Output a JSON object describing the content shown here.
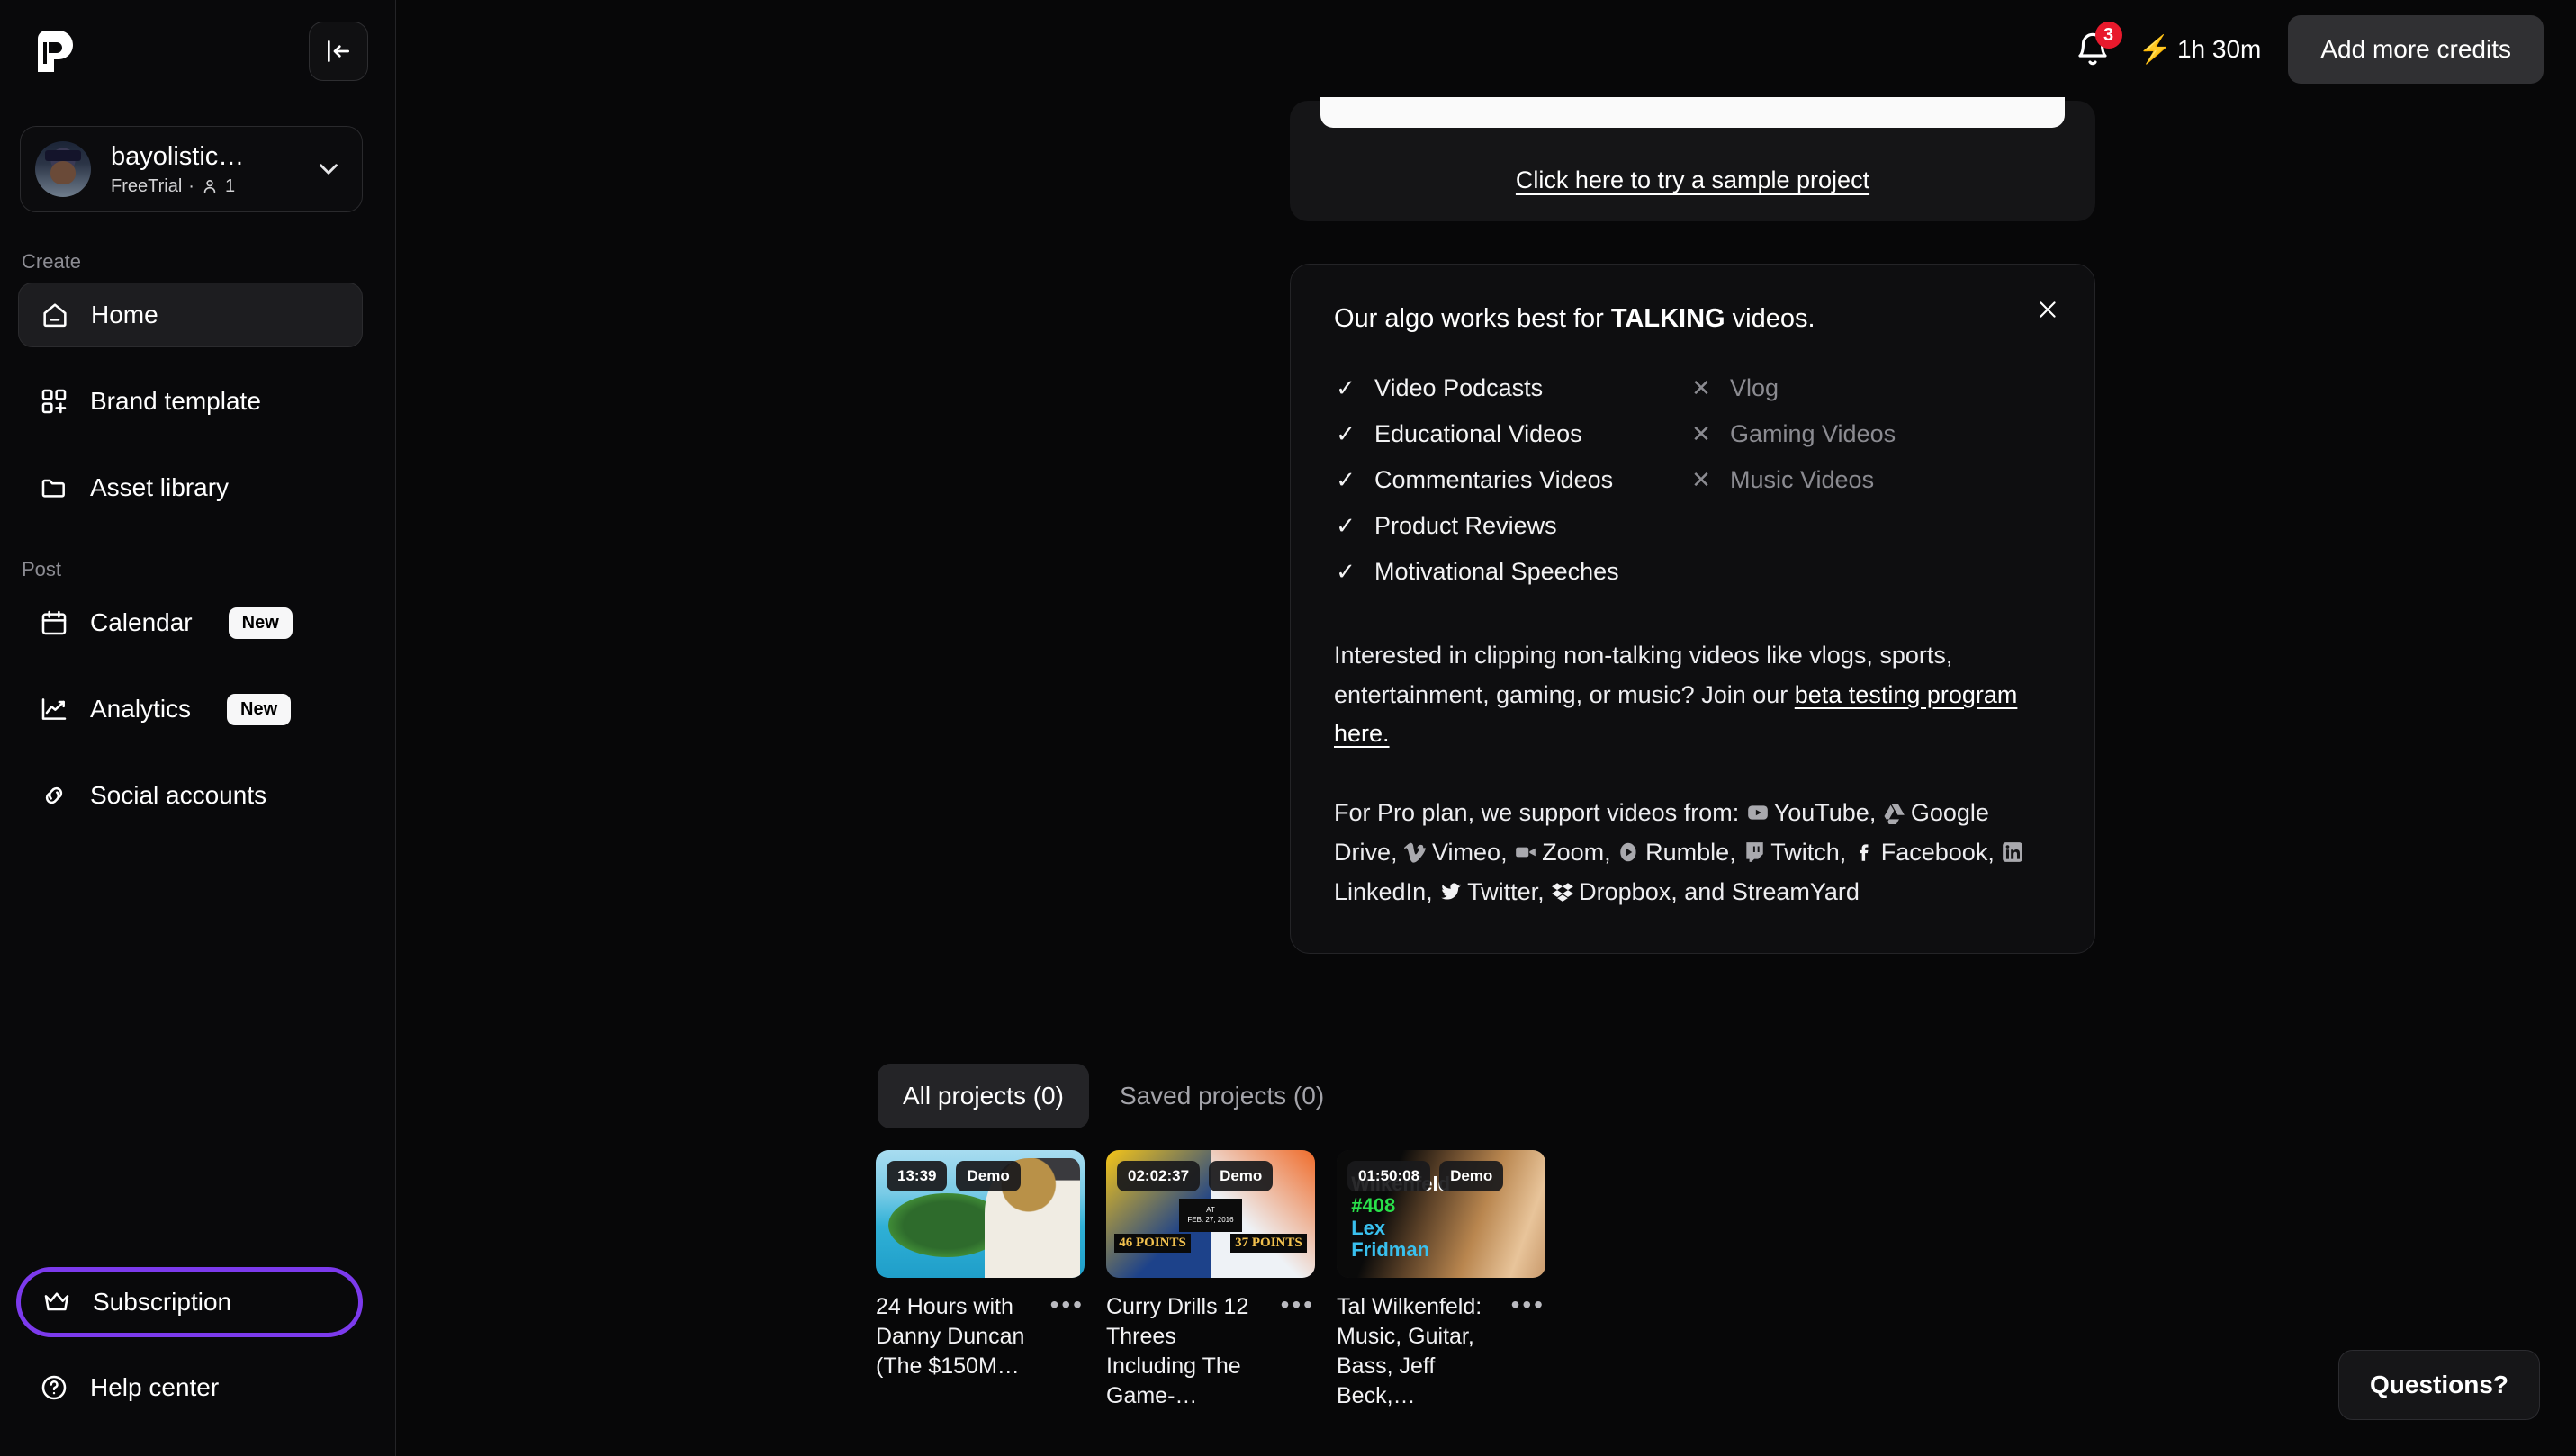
{
  "sidebar": {
    "logo": "opus-p-logo",
    "collapse_icon": "collapse-panel-icon",
    "account": {
      "name": "bayolistic…",
      "plan": "FreeTrial",
      "separator": "·",
      "seat_count": "1",
      "chevron": "chevron-down-icon"
    },
    "sections": [
      {
        "label": "Create",
        "items": [
          {
            "label": "Home",
            "icon": "home-icon",
            "active": true
          },
          {
            "label": "Brand template",
            "icon": "grid-plus-icon",
            "active": false
          },
          {
            "label": "Asset library",
            "icon": "folder-icon",
            "active": false
          }
        ]
      },
      {
        "label": "Post",
        "items": [
          {
            "label": "Calendar",
            "icon": "calendar-icon",
            "badge": "New"
          },
          {
            "label": "Analytics",
            "icon": "line-chart-icon",
            "badge": "New"
          },
          {
            "label": "Social accounts",
            "icon": "link-chain-icon",
            "badge": ""
          }
        ]
      }
    ],
    "bottom_items": [
      {
        "label": "Subscription",
        "icon": "crown-icon",
        "highlighted": true
      },
      {
        "label": "Help center",
        "icon": "question-circle-icon",
        "highlighted": false
      }
    ],
    "highlight_color": "#7c3aed"
  },
  "topbar": {
    "bell_icon": "notification-bell-icon",
    "notification_count": "3",
    "bolt_icon": "lightning-bolt-icon",
    "credits_remaining": "1h 30m",
    "add_credits_label": "Add more credits"
  },
  "upload_panel": {
    "sample_link": "Click here to try a sample project"
  },
  "info_card": {
    "close_icon": "close-x-icon",
    "title_prefix": "Our algo works best for ",
    "title_emphasis": "TALKING",
    "title_suffix": " videos.",
    "supported": [
      "Video Podcasts",
      "Educational Videos",
      "Commentaries Videos",
      "Product Reviews",
      "Motivational Speeches"
    ],
    "unsupported": [
      "Vlog",
      "Gaming Videos",
      "Music Videos"
    ],
    "check_mark": "✓",
    "cross_mark": "✕",
    "beta_text_before": "Interested in clipping non-talking videos like vlogs, sports, entertainment, gaming, or music? Join our ",
    "beta_link": "beta testing program here.",
    "sources_intro": "For Pro plan, we support videos from: ",
    "sources": [
      {
        "name": "YouTube",
        "icon": "youtube-icon"
      },
      {
        "name": "Google Drive",
        "icon": "google-drive-icon"
      },
      {
        "name": "Vimeo",
        "icon": "vimeo-icon"
      },
      {
        "name": "Zoom",
        "icon": "zoom-icon"
      },
      {
        "name": "Rumble",
        "icon": "rumble-icon"
      },
      {
        "name": "Twitch",
        "icon": "twitch-icon"
      },
      {
        "name": "Facebook",
        "icon": "facebook-icon"
      },
      {
        "name": "LinkedIn",
        "icon": "linkedin-icon"
      },
      {
        "name": "Twitter",
        "icon": "twitter-icon"
      },
      {
        "name": "Dropbox",
        "icon": "dropbox-icon"
      },
      {
        "name": "StreamYard",
        "icon": ""
      }
    ],
    "sources_conjunction": "and"
  },
  "projects": {
    "tabs": [
      {
        "label": "All projects (0)",
        "active": true
      },
      {
        "label": "Saved projects (0)",
        "active": false
      }
    ],
    "items": [
      {
        "duration": "13:39",
        "tag": "Demo",
        "title": "24 Hours with Danny Duncan (The $150M…",
        "menu_icon": "more-options-icon"
      },
      {
        "duration": "02:02:37",
        "tag": "Demo",
        "title": "Curry Drills 12 Threes Including The Game-…",
        "menu_icon": "more-options-icon",
        "thumb_text": {
          "left_points": "46 POINTS",
          "right_points": "37 POINTS",
          "mid_at": "AT",
          "mid_date": "FEB. 27, 2016"
        }
      },
      {
        "duration": "01:50:08",
        "tag": "Demo",
        "title": "Tal Wilkenfeld: Music, Guitar, Bass, Jeff Beck,…",
        "menu_icon": "more-options-icon",
        "thumb_text": {
          "line1": "Wilkenfeld",
          "line2": "#408",
          "line3": "Lex",
          "line4": "Fridman"
        }
      }
    ]
  },
  "help_widget": {
    "label": "Questions?"
  }
}
